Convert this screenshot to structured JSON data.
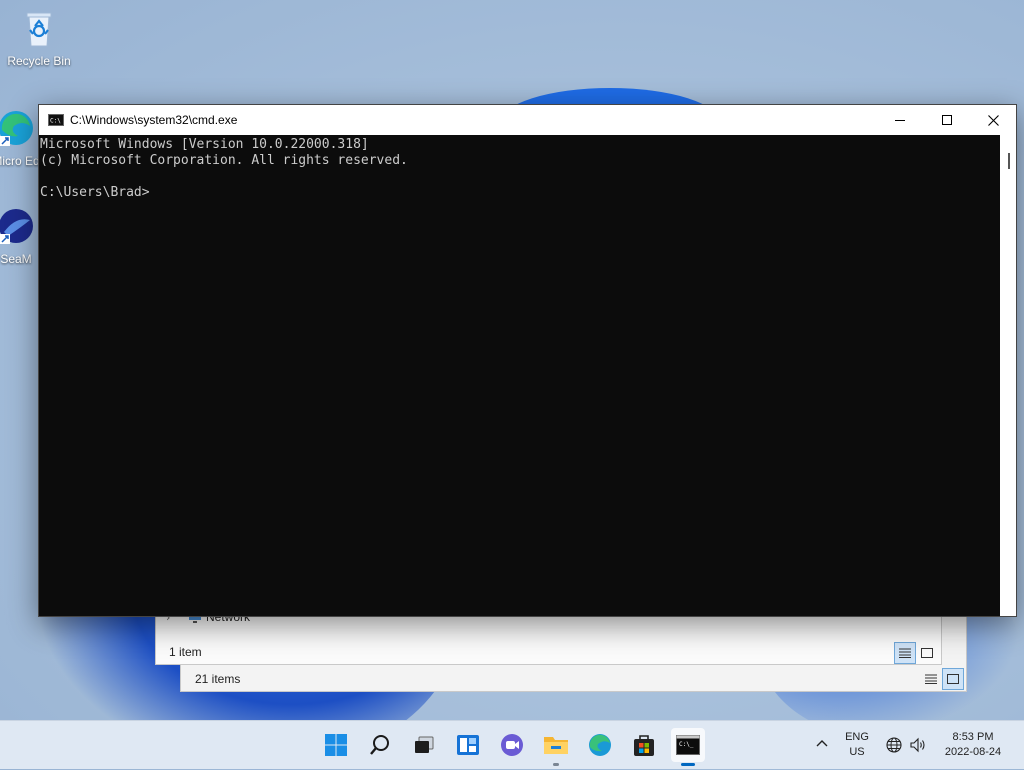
{
  "desktop": {
    "icons": [
      {
        "label": "Recycle Bin"
      },
      {
        "label": "Micro Ed"
      },
      {
        "label": "SeaM"
      }
    ]
  },
  "cmd": {
    "title": "C:\\Windows\\system32\\cmd.exe",
    "lines": [
      "Microsoft Windows [Version 10.0.22000.318]",
      "(c) Microsoft Corporation. All rights reserved.",
      "",
      "C:\\Users\\Brad>"
    ]
  },
  "explorer_front": {
    "nav_item": "Network",
    "status": "1 item"
  },
  "explorer_back": {
    "status": "21 items"
  },
  "taskbar": {
    "icons": [
      "start-icon",
      "search-icon",
      "task-view-icon",
      "widgets-icon",
      "chat-icon",
      "file-explorer-icon",
      "edge-icon",
      "store-icon",
      "terminal-icon"
    ],
    "accent": "#0067c0"
  },
  "tray": {
    "lang_line1": "ENG",
    "lang_line2": "US",
    "time": "8:53 PM",
    "date": "2022-08-24"
  }
}
